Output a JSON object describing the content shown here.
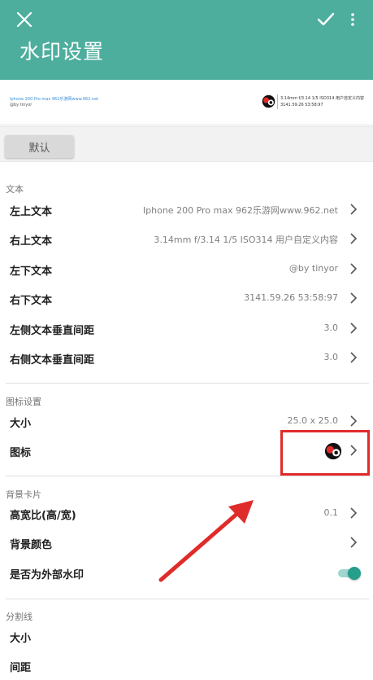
{
  "appbar": {
    "title": "水印设置",
    "icons": [
      "close-icon",
      "check-icon",
      "more-vert-icon"
    ]
  },
  "preview": {
    "top_left": "Iphone 200 Pro max 962乐游网www.962.net",
    "bottom_left": "@by tinyor",
    "top_right": "3.14mm f/3.14 1/5 ISO314 用户自定义内容",
    "bottom_right": "3141.59.26 53:58:97"
  },
  "default_button": "默认",
  "sections": {
    "text": "文本",
    "icon_settings": "图标设置",
    "background_card": "背景卡片",
    "divider": "分割线"
  },
  "text_rows": [
    {
      "label": "左上文本",
      "value": "Iphone 200 Pro max 962乐游网www.962.net"
    },
    {
      "label": "右上文本",
      "value": "3.14mm f/3.14 1/5 ISO314 用户自定义内容"
    },
    {
      "label": "左下文本",
      "value": "@by tinyor"
    },
    {
      "label": "右下文本",
      "value": "3141.59.26 53:58:97"
    },
    {
      "label": "左侧文本垂直间距",
      "value": "3.0"
    },
    {
      "label": "右侧文本垂直间距",
      "value": "3.0"
    }
  ],
  "icon_rows": [
    {
      "label": "大小",
      "value": "25.0 x 25.0"
    },
    {
      "label": "图标",
      "value": ""
    }
  ],
  "background_rows": [
    {
      "label": "高宽比(高/宽)",
      "value": "0.1"
    },
    {
      "label": "背景颜色",
      "value": ""
    },
    {
      "label": "是否为外部水印",
      "toggle_on": true
    }
  ],
  "divider_rows": [
    {
      "label": "大小"
    },
    {
      "label": "间距"
    }
  ],
  "colors": {
    "accent": "#4dae9e",
    "highlight": "#e02b2b",
    "toggle": "#259e8c"
  }
}
